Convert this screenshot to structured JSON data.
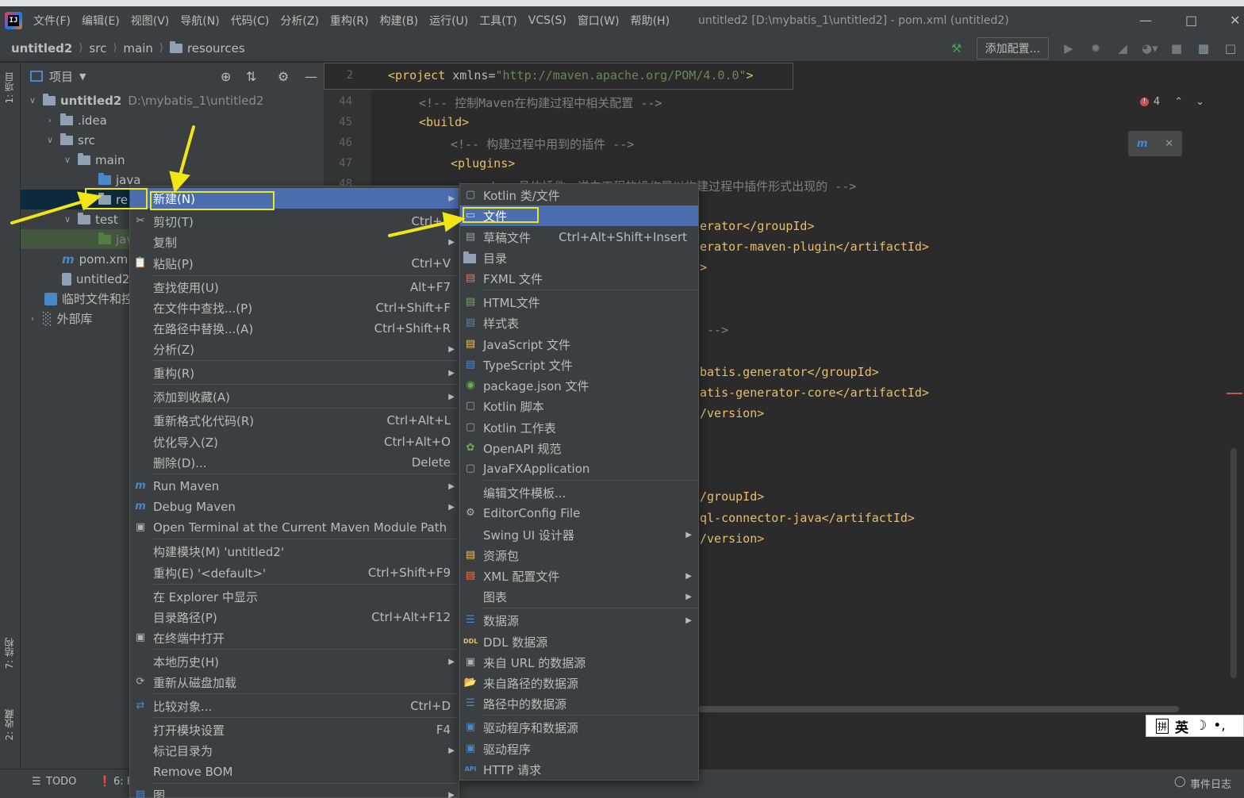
{
  "menubar": {
    "items": [
      "文件(F)",
      "编辑(E)",
      "视图(V)",
      "导航(N)",
      "代码(C)",
      "分析(Z)",
      "重构(R)",
      "构建(B)",
      "运行(U)",
      "工具(T)",
      "VCS(S)",
      "窗口(W)",
      "帮助(H)"
    ],
    "window_title": "untitled2 [D:\\mybatis_1\\untitled2] - pom.xml (untitled2)"
  },
  "breadcrumb": [
    "untitled2",
    "src",
    "main",
    "resources"
  ],
  "toolbar": {
    "add_config_label": "添加配置..."
  },
  "project_panel": {
    "title": "项目",
    "root_name": "untitled2",
    "root_path": "D:\\mybatis_1\\untitled2",
    "items": [
      ".idea",
      "src",
      "main",
      "java",
      "re",
      "test",
      "jav",
      "pom.xm",
      "untitled2",
      "临时文件和控",
      "外部库"
    ]
  },
  "side_tabs": {
    "project": "1: 项目",
    "structure": "7: 结构",
    "favorites": "2: 收藏"
  },
  "editor": {
    "sticky_line_no": "2",
    "sticky_tag": "<project",
    "sticky_attr": " xmlns=",
    "sticky_value": "\"http://maven.apache.org/POM/4.0.0\"",
    "line_numbers": [
      "44",
      "45",
      "46",
      "47",
      "48"
    ],
    "lines": {
      "l44": "<!-- 控制Maven在构建过程中相关配置 -->",
      "l45": "<build>",
      "l46": "<!-- 构建过程中用到的插件 -->",
      "l47": "<plugins>",
      "l48": "<!-- 具体插件，逆向工程的操作是以构建过程中插件形式出现的 -->",
      "f1": "erator</groupId>",
      "f2": "erator-maven-plugin</artifactId>",
      "f3": ">",
      "f4": " -->",
      "f5": "batis.generator</groupId>",
      "f6": "atis-generator-core</artifactId>",
      "f7": "/version>",
      "f8": "/groupId>",
      "f9": "ql-connector-java</artifactId>",
      "f10": "/version>"
    },
    "error_count": "4"
  },
  "ime": {
    "mode": "拼",
    "lang": "英"
  },
  "status": {
    "todo": "TODO",
    "problems": "6: I",
    "event_log": "事件日志"
  },
  "context_menu": {
    "items": [
      {
        "label": "新建(N)",
        "shortcut": "",
        "submenu": true,
        "icon": "new"
      },
      {
        "label": "剪切(T)",
        "shortcut": "Ctrl+X",
        "icon": "scissors-icon"
      },
      {
        "label": "复制",
        "shortcut": "",
        "submenu": true,
        "icon": ""
      },
      {
        "label": "粘贴(P)",
        "shortcut": "Ctrl+V",
        "icon": "clipboard-icon"
      },
      {
        "label": "查找使用(U)",
        "shortcut": "Alt+F7"
      },
      {
        "label": "在文件中查找...(P)",
        "shortcut": "Ctrl+Shift+F"
      },
      {
        "label": "在路径中替换...(A)",
        "shortcut": "Ctrl+Shift+R"
      },
      {
        "label": "分析(Z)",
        "submenu": true
      },
      {
        "label": "重构(R)",
        "submenu": true
      },
      {
        "label": "添加到收藏(A)",
        "submenu": true
      },
      {
        "label": "重新格式化代码(R)",
        "shortcut": "Ctrl+Alt+L"
      },
      {
        "label": "优化导入(Z)",
        "shortcut": "Ctrl+Alt+O"
      },
      {
        "label": "删除(D)...",
        "shortcut": "Delete"
      },
      {
        "label": "Run Maven",
        "submenu": true
      },
      {
        "label": "Debug Maven",
        "submenu": true
      },
      {
        "label": "Open Terminal at the Current Maven Module Path"
      },
      {
        "label": "构建模块(M) 'untitled2'"
      },
      {
        "label": "重构(E) '<default>'",
        "shortcut": "Ctrl+Shift+F9"
      },
      {
        "label": "在 Explorer 中显示"
      },
      {
        "label": "目录路径(P)",
        "shortcut": "Ctrl+Alt+F12"
      },
      {
        "label": "在终端中打开"
      },
      {
        "label": "本地历史(H)",
        "submenu": true
      },
      {
        "label": "重新从磁盘加载"
      },
      {
        "label": "比较对象...",
        "shortcut": "Ctrl+D"
      },
      {
        "label": "打开模块设置",
        "shortcut": "F4"
      },
      {
        "label": "标记目录为",
        "submenu": true
      },
      {
        "label": "Remove BOM"
      },
      {
        "label": "图",
        "submenu": true
      }
    ]
  },
  "new_submenu": {
    "items": [
      {
        "label": "Kotlin 类/文件"
      },
      {
        "label": "文件"
      },
      {
        "label": "草稿文件",
        "shortcut": "Ctrl+Alt+Shift+Insert"
      },
      {
        "label": "目录"
      },
      {
        "label": "FXML 文件"
      },
      {
        "label": "HTML文件"
      },
      {
        "label": "样式表"
      },
      {
        "label": "JavaScript 文件"
      },
      {
        "label": "TypeScript 文件"
      },
      {
        "label": "package.json 文件"
      },
      {
        "label": "Kotlin 脚本"
      },
      {
        "label": "Kotlin 工作表"
      },
      {
        "label": "OpenAPI 规范"
      },
      {
        "label": "JavaFXApplication"
      },
      {
        "label": "编辑文件模板..."
      },
      {
        "label": "EditorConfig File"
      },
      {
        "label": "Swing UI 设计器",
        "submenu": true
      },
      {
        "label": "资源包"
      },
      {
        "label": "XML 配置文件",
        "submenu": true
      },
      {
        "label": "图表",
        "submenu": true
      },
      {
        "label": "数据源",
        "submenu": true
      },
      {
        "label": "DDL 数据源"
      },
      {
        "label": "来自 URL 的数据源"
      },
      {
        "label": "来自路径的数据源"
      },
      {
        "label": "路径中的数据源"
      },
      {
        "label": "驱动程序和数据源"
      },
      {
        "label": "驱动程序"
      },
      {
        "label": "HTTP 请求"
      }
    ]
  },
  "colors": {
    "highlight": "#4b6eaf",
    "annotation": "#f0e614",
    "menu_bg": "#3c3f41",
    "editor_bg": "#2b2b2b",
    "xml_tag": "#e8bf6a"
  }
}
